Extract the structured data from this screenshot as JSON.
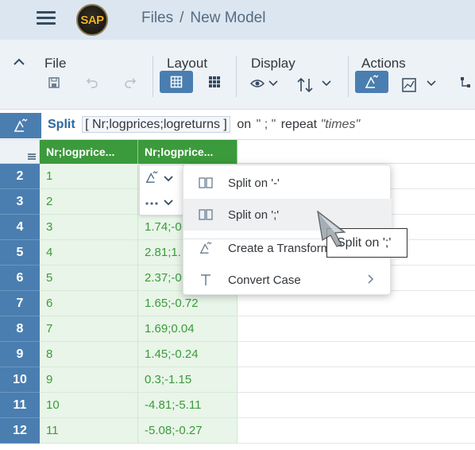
{
  "shell": {
    "logo_text": "SAP",
    "breadcrumb": [
      "Files",
      "New Model"
    ],
    "breadcrumb_sep": "/"
  },
  "toolbar": {
    "groups": {
      "file": "File",
      "layout": "Layout",
      "display": "Display",
      "actions": "Actions"
    },
    "icons": {
      "collapse": "chevron-up-icon",
      "save": "save-icon",
      "undo": "undo-icon",
      "redo": "redo-icon",
      "grid_layout": "table-layout-icon",
      "card_layout": "card-layout-icon",
      "show": "eye-icon",
      "sort": "sort-icon",
      "smart_transform": "transform-icon",
      "map": "geo-map-icon",
      "hierarchy": "hierarchy-icon"
    }
  },
  "formula": {
    "keyword": "Split",
    "column": "[ Nr;logprices;logreturns ]",
    "on_kw": "on",
    "delimiter": "\" ; \"",
    "repeat_kw": "repeat",
    "times": "\"times\""
  },
  "grid": {
    "columns": [
      "Nr;logprice...",
      "Nr;logprice..."
    ],
    "rows": [
      {
        "n": "2",
        "a": "1",
        "b": ""
      },
      {
        "n": "3",
        "a": "2",
        "b": ""
      },
      {
        "n": "4",
        "a": "3",
        "b": "1.74;-0"
      },
      {
        "n": "5",
        "a": "4",
        "b": "2.81;1."
      },
      {
        "n": "6",
        "a": "5",
        "b": "2.37;-0"
      },
      {
        "n": "7",
        "a": "6",
        "b": "1.65;-0.72"
      },
      {
        "n": "8",
        "a": "7",
        "b": "1.69;0.04"
      },
      {
        "n": "9",
        "a": "8",
        "b": "1.45;-0.24"
      },
      {
        "n": "10",
        "a": "9",
        "b": "0.3;-1.15"
      },
      {
        "n": "11",
        "a": "10",
        "b": "-4.81;-5.11"
      },
      {
        "n": "12",
        "a": "11",
        "b": "-5.08;-0.27"
      }
    ]
  },
  "menu": {
    "items": [
      {
        "label": "Split on '-'",
        "icon": "split-column-icon"
      },
      {
        "label": "Split on ';'",
        "icon": "split-column-icon"
      },
      {
        "label": "Create a Transform",
        "icon": "transform-icon"
      },
      {
        "label": "Convert Case",
        "icon": "text-case-icon"
      }
    ]
  },
  "tooltip": {
    "text": "Split on ';'"
  },
  "colors": {
    "shell_bg": "#dbe6f1",
    "toolbar_bg": "#edf2f7",
    "accent_blue": "#4a7eb0",
    "column_green": "#3b9a3b",
    "cell_green_bg": "#e8f5e8"
  }
}
